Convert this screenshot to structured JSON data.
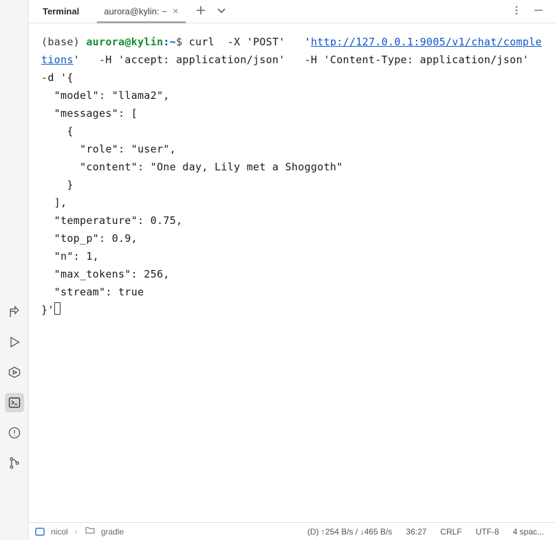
{
  "panel": {
    "title": "Terminal"
  },
  "tab": {
    "label": "aurora@kylin: ~"
  },
  "prompt": {
    "env": "(base) ",
    "user": "aurora@kylin",
    "colon": ":",
    "path": "~",
    "sigil": "$ "
  },
  "cmd": {
    "part1": "curl  -X 'POST'   '",
    "url": "http://127.0.0.1:9005/v1/chat/completions",
    "part2": "'   -H 'accept: application/json'   -H 'Content-Type: application/json'   -d '{",
    "lines": [
      "  \"model\": \"llama2\",",
      "  \"messages\": [",
      "    {",
      "      \"role\": \"user\",",
      "      \"content\": \"One day, Lily met a Shoggoth\"",
      "    }",
      "  ],",
      "  \"temperature\": 0.75,",
      "  \"top_p\": 0.9,",
      "  \"n\": 1,",
      "  \"max_tokens\": 256,",
      "  \"stream\": true",
      "}'"
    ]
  },
  "status": {
    "root": "nicol",
    "folder": "gradle",
    "net": "(D) ↑254 B/s / ↓465 B/s",
    "caret": "36:27",
    "eol": "CRLF",
    "enc": "UTF-8",
    "indent": "4 spac..."
  }
}
